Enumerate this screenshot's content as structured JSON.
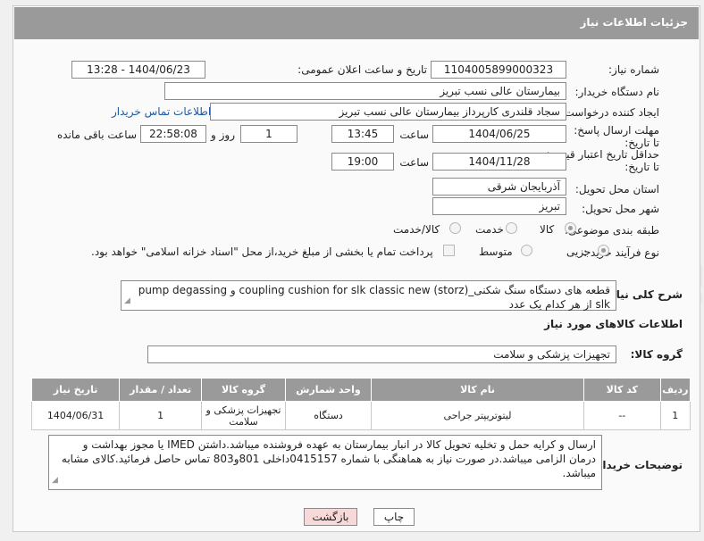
{
  "title": "جزئیات اطلاعات نیاز",
  "labels": {
    "need_number": "شماره نیاز:",
    "announce_datetime": "تاریخ و ساعت اعلان عمومی:",
    "buyer_org": "نام دستگاه خریدار:",
    "requester": "ایجاد کننده درخواست:",
    "response_deadline": "مهلت ارسال پاسخ: تا تاریخ:",
    "time_word": "ساعت",
    "day_and": "روز و",
    "remaining": "ساعت باقی مانده",
    "price_validity": "حداقل تاریخ اعتبار قیمت: تا تاریخ:",
    "province": "استان محل تحویل:",
    "city": "شهر محل تحویل:",
    "category": "طبقه بندی موضوعی:",
    "process_type": "نوع فرآیند خرید :",
    "description": "شرح کلی نیاز:",
    "goods_info": "اطلاعات کالاهای مورد نیاز",
    "goods_group": "گروه کالا:",
    "buyer_notes": "توضیحات خریدار:"
  },
  "values": {
    "need_number": "1104005899000323",
    "announce_datetime": "1404/06/23 - 13:28",
    "buyer_org": "بیمارستان عالی نسب تبریز",
    "requester": "سجاد قلندری کارپرداز بیمارستان عالی نسب تبریز",
    "contact_link": "اطلاعات تماس خریدار",
    "response_date": "1404/06/25",
    "response_time": "13:45",
    "days": "1",
    "remaining_time": "22:58:08",
    "price_date": "1404/11/28",
    "price_time": "19:00",
    "province": "آذربایجان شرقی",
    "city": "تبریز",
    "description": "قطعه های دستگاه سنگ شکنی_coupling cushion for slk classic new (storz) و pump degassing slk از هر کدام یک عدد",
    "goods_group": "تجهیزات پزشکی و سلامت",
    "buyer_notes": "ارسال و کرایه حمل و تخلیه  تحویل کالا در انبار بیمارستان به عهده فروشنده میباشد.داشتن IMED یا مجوز بهداشت و درمان الزامی میباشد.در صورت نیاز به هماهنگی با شماره 0415157داخلی 801و803 تماس حاصل فرمائید.کالای مشابه میباشد."
  },
  "category_options": [
    {
      "label": "کالا",
      "selected": true
    },
    {
      "label": "خدمت",
      "selected": false
    },
    {
      "label": "کالا/خدمت",
      "selected": false
    }
  ],
  "process_options": [
    {
      "label": "جزیی",
      "selected": true
    },
    {
      "label": "متوسط",
      "selected": false
    }
  ],
  "payment_note": "پرداخت تمام یا بخشی از مبلغ خرید،از محل \"اسناد خزانه اسلامی\" خواهد بود.",
  "table": {
    "headers": [
      "ردیف",
      "کد کالا",
      "نام کالا",
      "واحد شمارش",
      "گروه کالا",
      "تعداد / مقدار",
      "تاریخ نیاز"
    ],
    "rows": [
      [
        "1",
        "--",
        "لیتوتریپتر جراحی",
        "دستگاه",
        "تجهیزات پزشکی و سلامت",
        "1",
        "1404/06/31"
      ]
    ]
  },
  "buttons": {
    "print": "چاپ",
    "back": "بازگشت"
  },
  "watermark": "AriaTender.neT",
  "colors": {
    "header_gray": "#9a9a9a",
    "link_blue": "#1a5aa6",
    "back_button_bg": "#f7d9d9",
    "watermark": "#ece6e6"
  }
}
